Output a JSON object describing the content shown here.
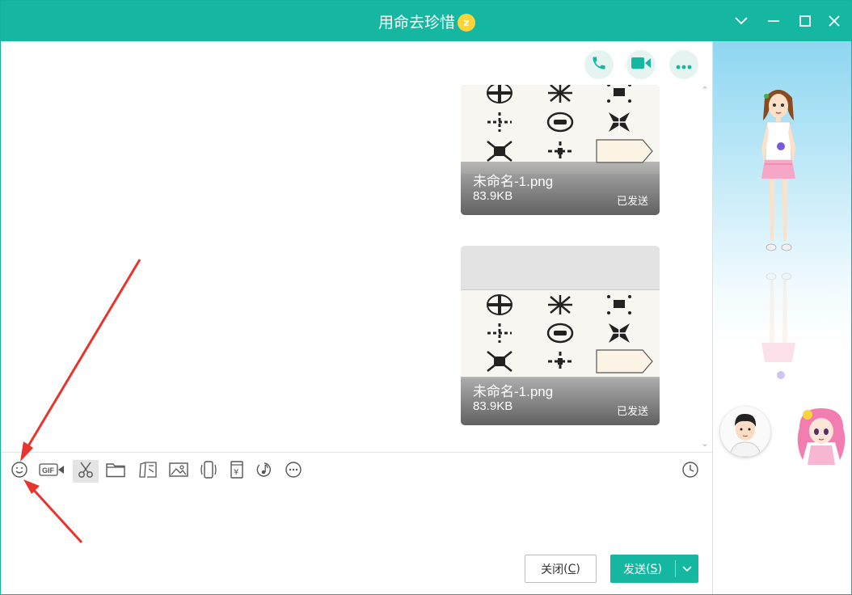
{
  "window": {
    "title": "用命去珍惜",
    "badge_icon": "gold-star-level-icon",
    "controls": [
      "chevron-down-icon",
      "minimize-icon",
      "maximize-icon",
      "close-icon"
    ]
  },
  "call_actions": [
    {
      "name": "voice-call",
      "icon": "phone-icon"
    },
    {
      "name": "video-call",
      "icon": "video-camera-icon"
    },
    {
      "name": "more",
      "icon": "more-dots-icon"
    }
  ],
  "messages": [
    {
      "file_name": "未命名-1.png",
      "file_size": "83.9KB",
      "status": "已发送"
    },
    {
      "file_name": "未命名-1.png",
      "file_size": "83.9KB",
      "status": "已发送"
    }
  ],
  "toolbar": {
    "tools": [
      {
        "name": "emoji",
        "icon": "smiley-icon"
      },
      {
        "name": "gif",
        "icon": "gif-camera-icon",
        "label": "GIF"
      },
      {
        "name": "screenshot",
        "icon": "scissors-icon"
      },
      {
        "name": "file",
        "icon": "folder-icon"
      },
      {
        "name": "doodle",
        "icon": "shapes-icon"
      },
      {
        "name": "image",
        "icon": "picture-icon"
      },
      {
        "name": "shake",
        "icon": "phone-shake-icon"
      },
      {
        "name": "red-packet",
        "icon": "yen-packet-icon"
      },
      {
        "name": "music",
        "icon": "music-icon"
      },
      {
        "name": "more",
        "icon": "more-circle-icon"
      }
    ],
    "history_icon": "clock-icon"
  },
  "buttons": {
    "close_label": "关闭",
    "close_hotkey": "C",
    "send_label": "发送",
    "send_hotkey": "S"
  },
  "colors": {
    "accent": "#15b7a0",
    "annotation_arrow": "#e8342f",
    "file_card_overlay": "#6e6e6e"
  }
}
